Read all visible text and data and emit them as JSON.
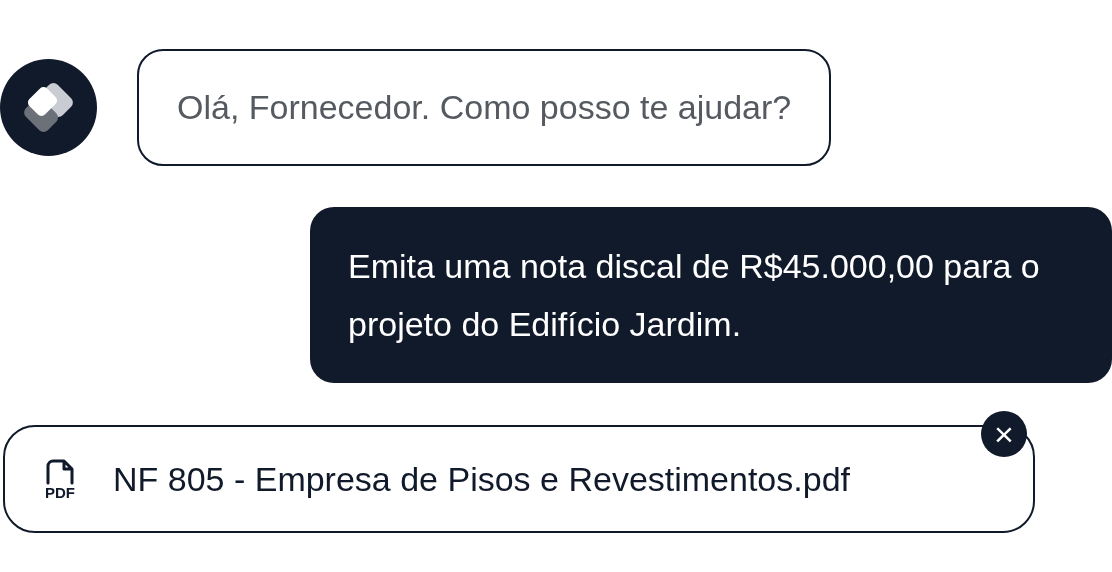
{
  "messages": [
    {
      "kind": "bot",
      "text": "Olá, Fornecedor. Como posso te ajudar?"
    },
    {
      "kind": "user",
      "text": "Emita uma nota discal de R$45.000,00 para o projeto do Edifício Jardim."
    },
    {
      "kind": "attachment",
      "file_type": "PDF",
      "text": "NF 805 - Empresa de Pisos e Revestimentos.pdf",
      "close": "×"
    }
  ]
}
